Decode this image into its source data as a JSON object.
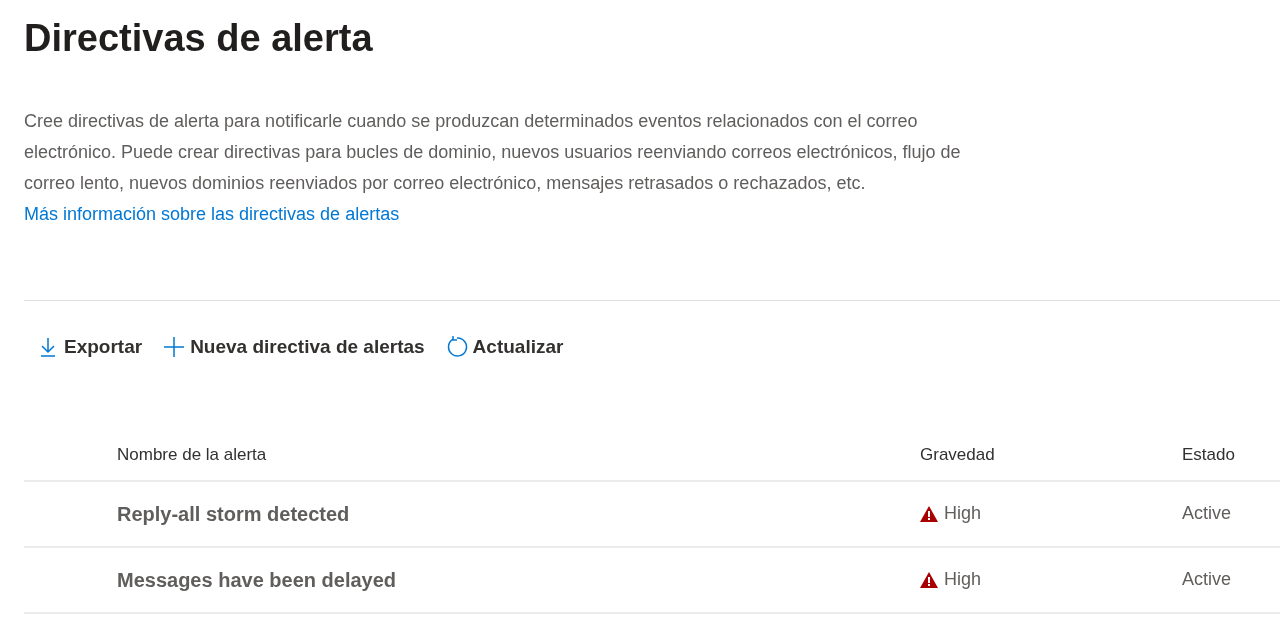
{
  "title": "Directivas de alerta",
  "description": {
    "text": "Cree directivas de alerta para notificarle cuando se produzcan determinados eventos relacionados con el correo electrónico. Puede crear directivas para bucles de dominio, nuevos usuarios reenviando correos electrónicos, flujo de correo lento, nuevos dominios reenviados por correo electrónico, mensajes retrasados o rechazados, etc.",
    "link": "Más información sobre las directivas de alertas"
  },
  "toolbar": [
    {
      "kind": "export",
      "label": "Exportar"
    },
    {
      "kind": "new",
      "label": "Nueva directiva de alertas"
    },
    {
      "kind": "refresh",
      "label": "Actualizar"
    }
  ],
  "table": {
    "columns": [
      "Nombre de la alerta",
      "Gravedad",
      "Estado"
    ],
    "rows": [
      {
        "name": "Reply-all storm detected",
        "severity": {
          "kind": "high",
          "label": "High"
        },
        "status": "Active"
      },
      {
        "name": "Messages have been delayed",
        "severity": {
          "kind": "high",
          "label": "High"
        },
        "status": "Active"
      }
    ]
  }
}
